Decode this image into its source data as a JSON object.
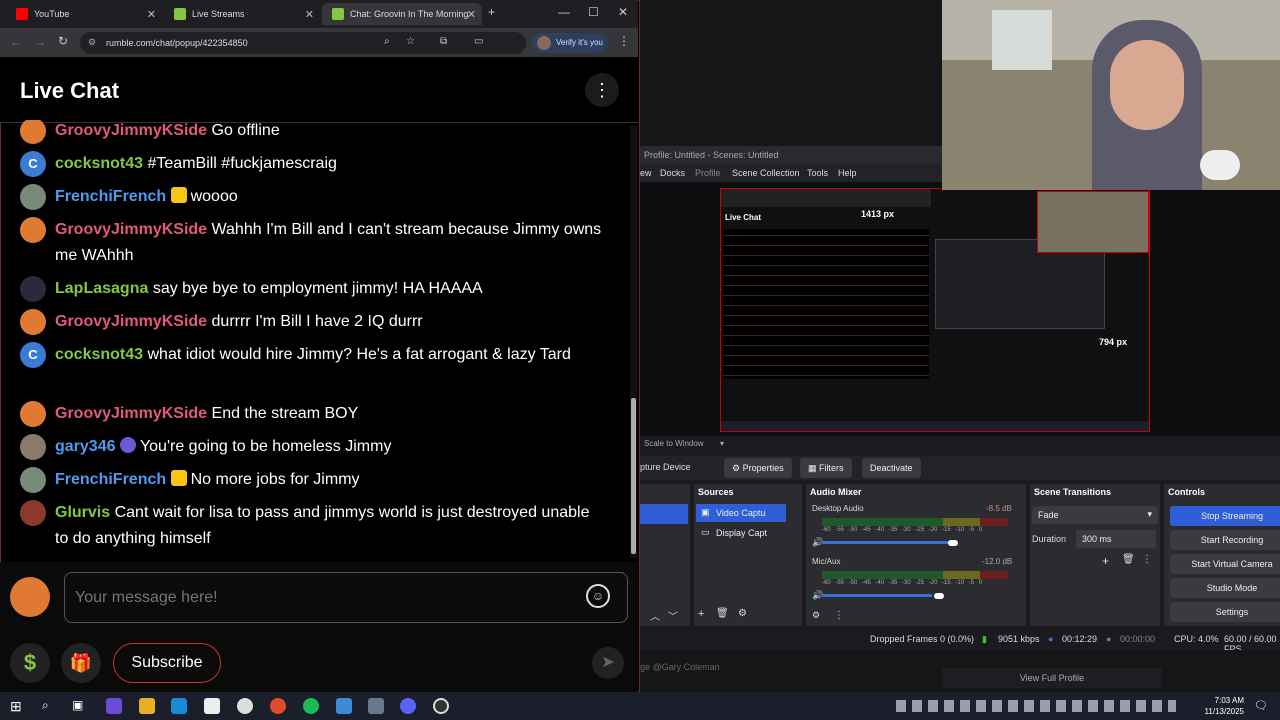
{
  "browser": {
    "tabs": [
      {
        "label": "YouTube",
        "color": "#ff0000"
      },
      {
        "label": "Live Streams",
        "color": "#85c742"
      },
      {
        "label": "Chat: Groovin In The Morning",
        "color": "#85c742"
      }
    ],
    "url": "rumble.com/chat/popup/422354850",
    "verify_label": "Verify it's you"
  },
  "chat": {
    "title": "Live Chat",
    "messages": [
      {
        "user": "GroovyJimmyKSide",
        "color": "#e05a7a",
        "text": "Go offline",
        "avatar": "#e07a32"
      },
      {
        "user": "cocksnot43",
        "color": "#85c742",
        "text": "#TeamBill #fuckjamescraig",
        "avatar": "#3a7bd5",
        "initial": "C"
      },
      {
        "user": "FrenchiFrench",
        "color": "#4e9bf0",
        "text": "woooo",
        "avatar": "#7a8a7a",
        "badge": true
      },
      {
        "user": "GroovyJimmyKSide",
        "color": "#e05a7a",
        "text": "Wahhh I'm Bill and I can't stream because Jimmy owns me WAhhh",
        "avatar": "#e07a32"
      },
      {
        "user": "LapLasagna",
        "color": "#85c742",
        "text": "say bye bye to employment jimmy! HA HAAAA",
        "avatar": "#2a2a3a"
      },
      {
        "user": "GroovyJimmyKSide",
        "color": "#e05a7a",
        "text": "durrrr I'm Bill I have 2 IQ durrr",
        "avatar": "#e07a32"
      },
      {
        "user": "cocksnot43",
        "color": "#85c742",
        "text": "what idiot would hire Jimmy? He's a fat arrogant & lazy Tard",
        "avatar": "#3a7bd5",
        "initial": "C"
      },
      {
        "user": "GroovyJimmyKSide",
        "color": "#e05a7a",
        "text": "End the stream BOY",
        "avatar": "#e07a32"
      },
      {
        "user": "gary346",
        "color": "#4e9bf0",
        "text": "You're going to be homeless Jimmy",
        "avatar": "#8a7a6a",
        "shield": true
      },
      {
        "user": "FrenchiFrench",
        "color": "#4e9bf0",
        "text": "No more jobs for Jimmy",
        "avatar": "#7a8a7a",
        "badge": true
      },
      {
        "user": "Glurvis",
        "color": "#85c742",
        "text": "Cant wait for lisa to pass and jimmys world is just destroyed unable to do anything himself",
        "avatar": "#8a3a2a"
      }
    ],
    "input_placeholder": "Your message here!",
    "subscribe_label": "Subscribe",
    "dollar_label": "$"
  },
  "obs": {
    "title": "Profile: Untitled - Scenes: Untitled",
    "menu": [
      "ew",
      "Docks",
      "Profile",
      "Scene Collection",
      "Tools",
      "Help"
    ],
    "preview_labels": {
      "width_label": "1413 px",
      "height_label": "794 px"
    },
    "nested_chat_title": "Live Chat",
    "scale_label": "Scale to Window",
    "toolbar": {
      "source": "pture Device",
      "properties": "Properties",
      "filters": "Filters",
      "deactivate": "Deactivate"
    },
    "docks": {
      "sources_title": "Sources",
      "sources": [
        "Video Captu",
        "Display Capt"
      ],
      "mixer_title": "Audio Mixer",
      "mixer": [
        {
          "name": "Desktop Audio",
          "db": "-8.5 dB",
          "level": 0.85
        },
        {
          "name": "Mic/Aux",
          "db": "-12.0 dB",
          "level": 0.65
        }
      ],
      "meter_ticks": "-60 -55 -50 -45 -40 -35 -30 -25 -20 -15 -10 -5 0",
      "transitions_title": "Scene Transitions",
      "transition": "Fade",
      "duration_label": "Duration",
      "duration_value": "300 ms",
      "controls_title": "Controls",
      "controls": [
        "Stop Streaming",
        "Start Recording",
        "Start Virtual Camera",
        "Studio Mode",
        "Settings"
      ]
    },
    "status": {
      "dropped": "Dropped Frames 0 (0.0%)",
      "kbps": "9051 kbps",
      "live_time": "00:12:29",
      "rec_time": "00:00:00",
      "cpu": "CPU: 4.0%",
      "fps": "60.00 / 60.00 FPS"
    },
    "lower": {
      "message_placeholder": "ge @Gary Coleman",
      "profile_button": "View Full Profile"
    }
  },
  "taskbar": {
    "time": "7:03 AM",
    "date": "11/13/2025"
  }
}
